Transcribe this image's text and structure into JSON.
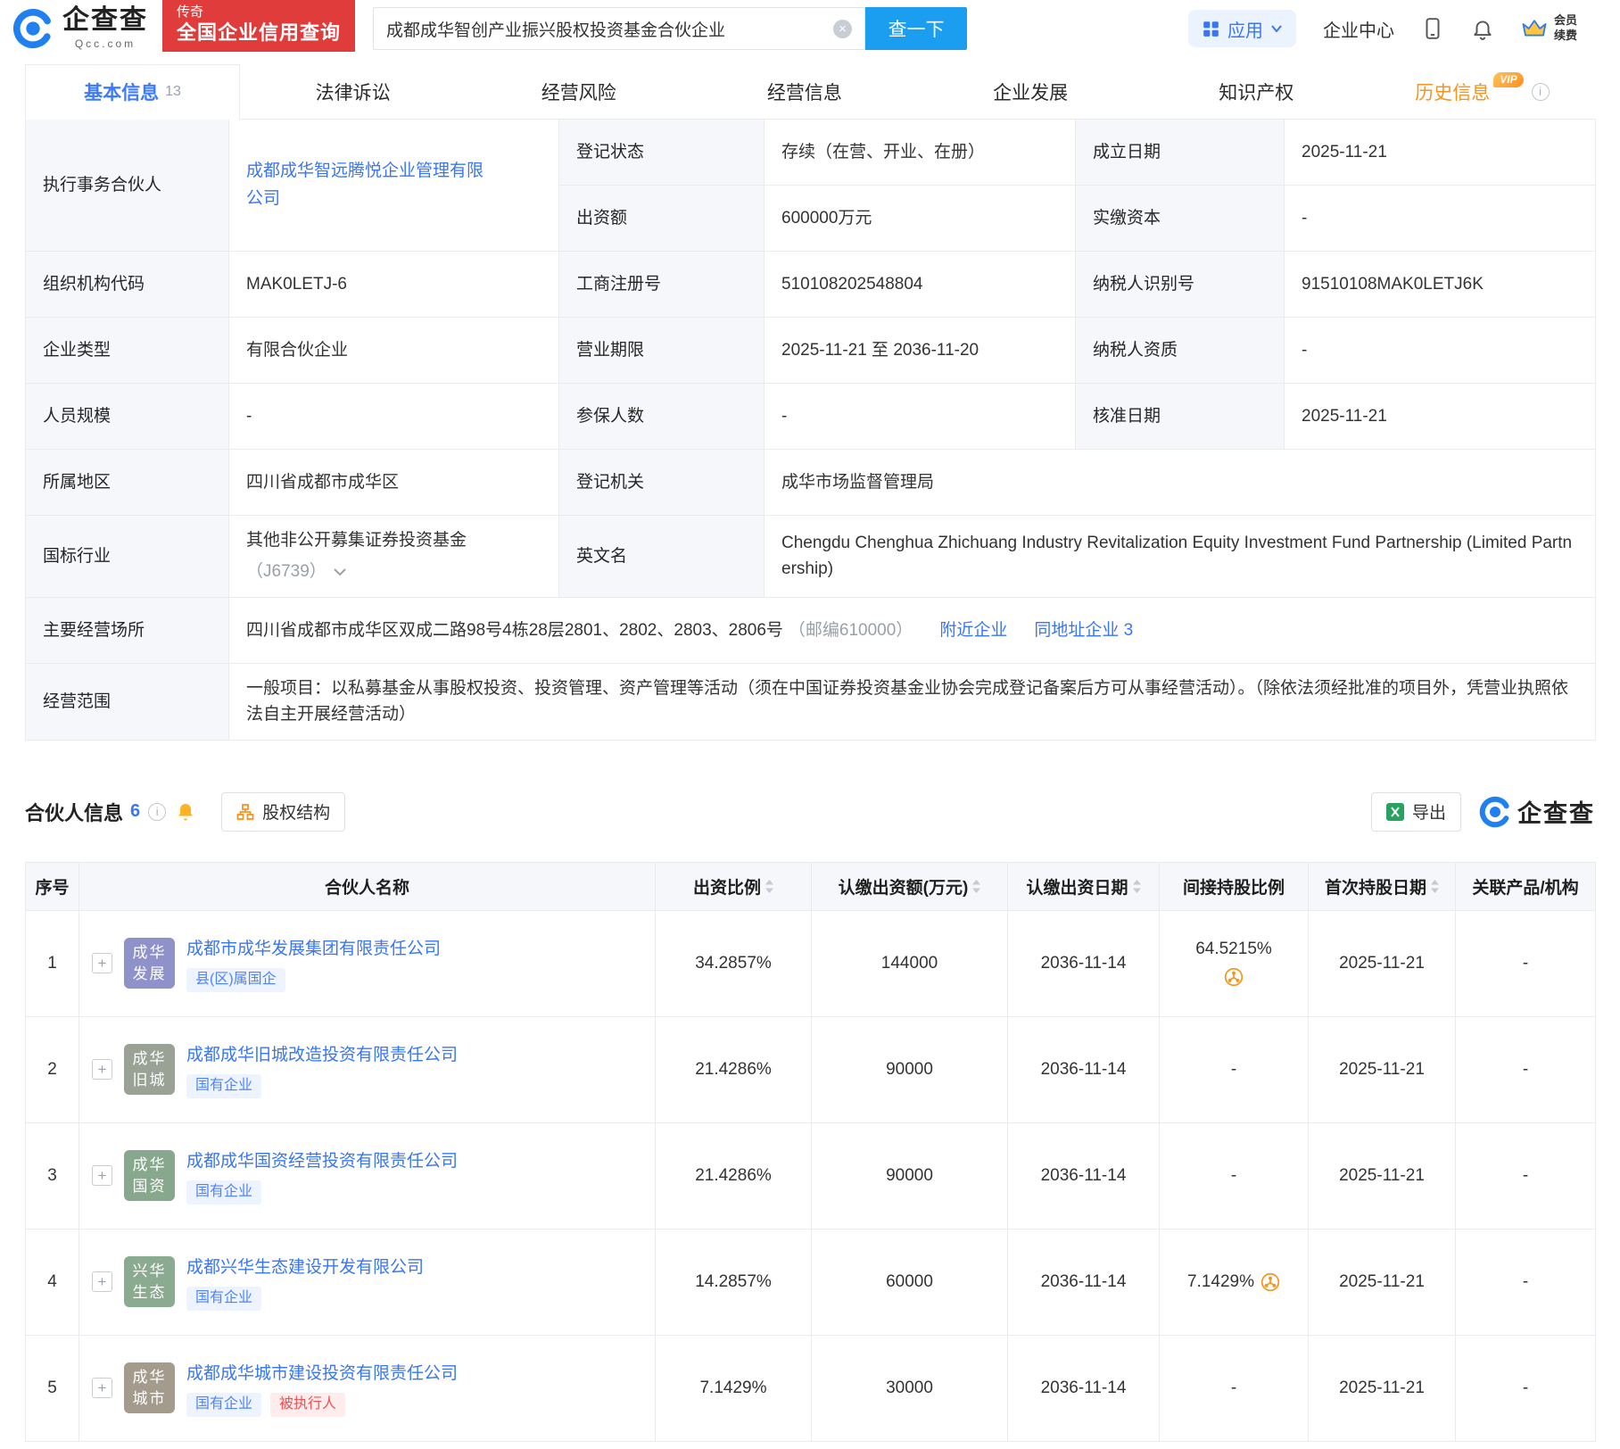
{
  "colors": {
    "brand_blue": "#2080F0",
    "link_blue": "#3976F6",
    "search_button_blue": "#1B9DF0",
    "promo_red": "#E13C3C",
    "history_orange": "#F7941E",
    "tag_blue_text": "#4E83FB",
    "tag_blue_bg": "#EDF4FF",
    "tag_red_text": "#F05050",
    "tag_red_bg": "#FFECEC",
    "label_cell_bg": "#F5F7FA",
    "table_border": "#E9EBEF"
  },
  "header": {
    "logo_title": "企查查",
    "logo_domain": "Qcc.com",
    "promo_top": "传奇",
    "promo_main": "全国企业信用查询",
    "search_value": "成都成华智创产业振兴股权投资基金合伙企业",
    "search_btn": "查一下",
    "apps": "应用",
    "enterprise_center": "企业中心",
    "vip_top": "会员",
    "vip_bottom": "续费"
  },
  "tabs": {
    "vip_badge": "VIP",
    "items": [
      {
        "label": "基本信息",
        "count": "13"
      },
      {
        "label": "法律诉讼"
      },
      {
        "label": "经营风险"
      },
      {
        "label": "经营信息"
      },
      {
        "label": "企业发展"
      },
      {
        "label": "知识产权"
      },
      {
        "label": "历史信息"
      }
    ]
  },
  "basic_info": {
    "exec": {
      "label": "执行事务合伙人",
      "value": "成都成华智远腾悦企业管理有限公司"
    },
    "status": {
      "label": "登记状态",
      "value": "存续（在营、开业、在册）"
    },
    "established": {
      "label": "成立日期",
      "value": "2025-11-21"
    },
    "capital": {
      "label": "出资额",
      "value": "600000万元"
    },
    "paid_in": {
      "label": "实缴资本",
      "value": "-"
    },
    "org_code": {
      "label": "组织机构代码",
      "value": "MAK0LETJ-6"
    },
    "reg_no": {
      "label": "工商注册号",
      "value": "510108202548804"
    },
    "tax_id": {
      "label": "纳税人识别号",
      "value": "91510108MAK0LETJ6K"
    },
    "company_type": {
      "label": "企业类型",
      "value": "有限合伙企业"
    },
    "term": {
      "label": "营业期限",
      "value": "2025-11-21 至 2036-11-20"
    },
    "tax_qual": {
      "label": "纳税人资质",
      "value": "-"
    },
    "staff": {
      "label": "人员规模",
      "value": "-"
    },
    "insured": {
      "label": "参保人数",
      "value": "-"
    },
    "approval": {
      "label": "核准日期",
      "value": "2025-11-21"
    },
    "region": {
      "label": "所属地区",
      "value": "四川省成都市成华区"
    },
    "authority": {
      "label": "登记机关",
      "value": "成华市场监督管理局"
    },
    "industry": {
      "label": "国标行业",
      "value": "其他非公开募集证券投资基金",
      "code": "（J6739）"
    },
    "en_name": {
      "label": "英文名",
      "value": "Chengdu Chenghua Zhichuang Industry Revitalization Equity Investment Fund Partnership (Limited Partnership)"
    },
    "address": {
      "label": "主要经营场所",
      "value": "四川省成都市成华区双成二路98号4栋28层2801、2802、2803、2806号",
      "postal": "（邮编610000）",
      "link_nearby": "附近企业",
      "link_same_address": "同地址企业 3"
    },
    "scope": {
      "label": "经营范围",
      "value": "一般项目：以私募基金从事股权投资、投资管理、资产管理等活动（须在中国证券投资基金业协会完成登记备案后方可从事经营活动）。（除依法须经批准的项目外，凭营业执照依法自主开展经营活动）"
    }
  },
  "partners": {
    "title": "合伙人信息",
    "count": "6",
    "equity_btn": "股权结构",
    "export_btn": "导出",
    "logo_text": "企查查",
    "columns": [
      "序号",
      "合伙人名称",
      "出资比例",
      "认缴出资额(万元)",
      "认缴出资日期",
      "间接持股比例",
      "首次持股日期",
      "关联产品/机构"
    ],
    "rows": [
      {
        "seq": "1",
        "avatar": [
          "成华",
          "发展"
        ],
        "avatar_color": "#8F91C9",
        "name": "成都市成华发展集团有限责任公司",
        "tags": [
          {
            "text": "县(区)属国企",
            "type": "blue"
          }
        ],
        "ratio": "34.2857%",
        "amount": "144000",
        "date": "2036-11-14",
        "indirect": "64.5215%",
        "indirect_icon": "below",
        "first_date": "2025-11-21",
        "related": "-"
      },
      {
        "seq": "2",
        "avatar": [
          "成华",
          "旧城"
        ],
        "avatar_color": "#99A294",
        "name": "成都成华旧城改造投资有限责任公司",
        "tags": [
          {
            "text": "国有企业",
            "type": "blue"
          }
        ],
        "ratio": "21.4286%",
        "amount": "90000",
        "date": "2036-11-14",
        "indirect": "-",
        "indirect_icon": "none",
        "first_date": "2025-11-21",
        "related": "-"
      },
      {
        "seq": "3",
        "avatar": [
          "成华",
          "国资"
        ],
        "avatar_color": "#87A88C",
        "name": "成都成华国资经营投资有限责任公司",
        "tags": [
          {
            "text": "国有企业",
            "type": "blue"
          }
        ],
        "ratio": "21.4286%",
        "amount": "90000",
        "date": "2036-11-14",
        "indirect": "-",
        "indirect_icon": "none",
        "first_date": "2025-11-21",
        "related": "-"
      },
      {
        "seq": "4",
        "avatar": [
          "兴华",
          "生态"
        ],
        "avatar_color": "#8AAB90",
        "name": "成都兴华生态建设开发有限公司",
        "tags": [
          {
            "text": "国有企业",
            "type": "blue"
          }
        ],
        "ratio": "14.2857%",
        "amount": "60000",
        "date": "2036-11-14",
        "indirect": "7.1429%",
        "indirect_icon": "inline",
        "first_date": "2025-11-21",
        "related": "-"
      },
      {
        "seq": "5",
        "avatar": [
          "成华",
          "城市"
        ],
        "avatar_color": "#A49B8D",
        "name": "成都成华城市建设投资有限责任公司",
        "tags": [
          {
            "text": "国有企业",
            "type": "blue"
          },
          {
            "text": "被执行人",
            "type": "red"
          }
        ],
        "ratio": "7.1429%",
        "amount": "30000",
        "date": "2036-11-14",
        "indirect": "-",
        "indirect_icon": "none",
        "first_date": "2025-11-21",
        "related": "-"
      }
    ]
  }
}
